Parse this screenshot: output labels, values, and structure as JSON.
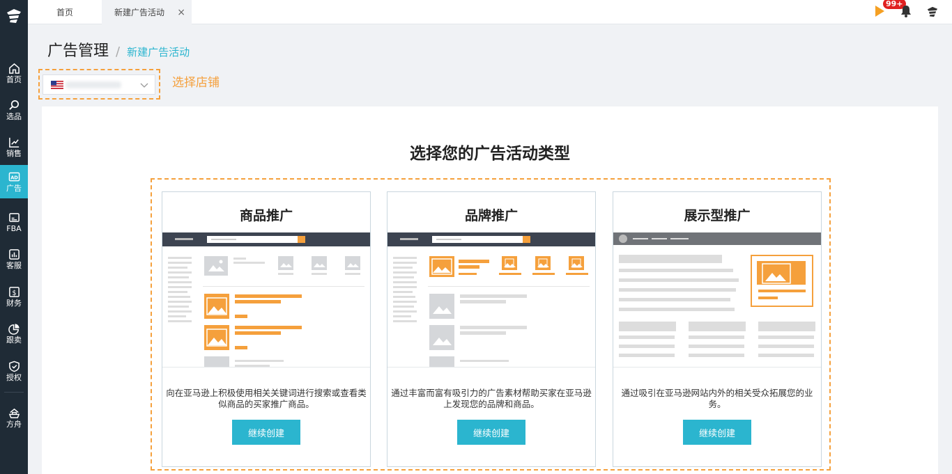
{
  "sidebar": {
    "logo_icon": "ship-captain-logo-icon",
    "items": [
      {
        "label": "首页",
        "icon": "home-icon"
      },
      {
        "label": "选品",
        "icon": "search-icon"
      },
      {
        "label": "销售",
        "icon": "trend-icon"
      },
      {
        "label": "广告",
        "icon": "ad-icon",
        "active": true
      },
      {
        "label": "FBA",
        "icon": "box-icon"
      },
      {
        "label": "客服",
        "icon": "chart-icon"
      },
      {
        "label": "财务",
        "icon": "dollar-icon"
      },
      {
        "label": "跟卖",
        "icon": "pie-icon"
      },
      {
        "label": "授权",
        "icon": "shield-icon"
      },
      {
        "label": "方舟",
        "icon": "ark-icon"
      }
    ]
  },
  "tabs": {
    "home": "首页",
    "current": "新建广告活动",
    "close_symbol": "×"
  },
  "top_right": {
    "badge": "99+"
  },
  "breadcrumb": {
    "title": "广告管理",
    "separator": "/",
    "current": "新建广告活动"
  },
  "store": {
    "hint": "选择店铺"
  },
  "main": {
    "heading": "选择您的广告活动类型",
    "cards": [
      {
        "title": "商品推广",
        "description": "向在亚马逊上积极使用相关关键词进行搜索或查看类似商品的买家推广商品。",
        "button": "继续创建"
      },
      {
        "title": "品牌推广",
        "description": "通过丰富而富有吸引力的广告素材帮助买家在亚马逊上发现您的品牌和商品。",
        "button": "继续创建"
      },
      {
        "title": "展示型推广",
        "description": "通过吸引在亚马逊网站内外的相关受众拓展您的业务。",
        "button": "继续创建"
      }
    ]
  },
  "colors": {
    "accent": "#2bb5cf",
    "highlight": "#f5a03c",
    "sidebar_bg": "#1f2b36"
  }
}
